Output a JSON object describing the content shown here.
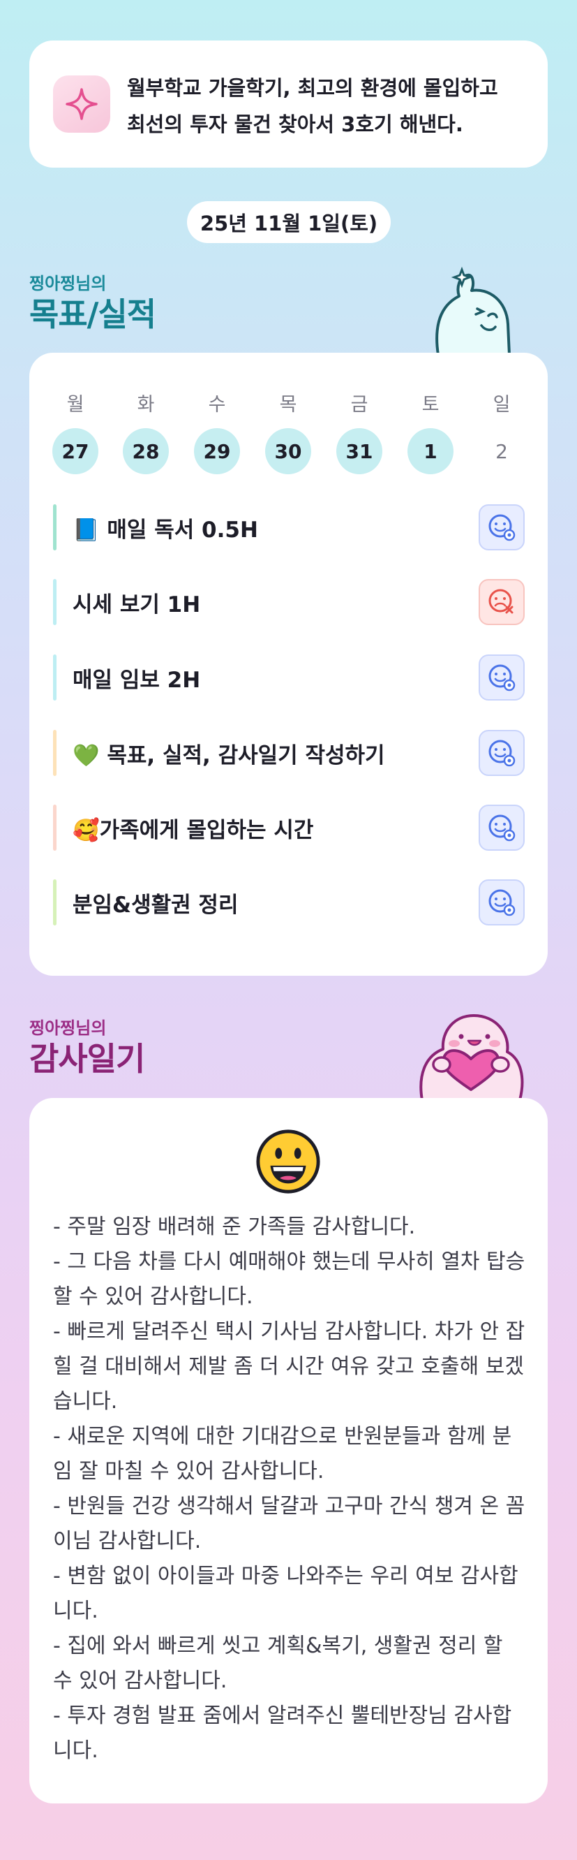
{
  "motto": {
    "icon": "sparkle-icon",
    "text": "월부학교 가을학기, 최고의 환경에 몰입하고\n최선의 투자 물건 찾아서 3호기 해낸다."
  },
  "date": "25년 11월 1일(토)",
  "goals_section": {
    "subtitle": "찡아찡님의",
    "title": "목표/실적",
    "week": {
      "day_names": [
        "월",
        "화",
        "수",
        "목",
        "금",
        "토",
        "일"
      ],
      "day_numbers": [
        "27",
        "28",
        "29",
        "30",
        "31",
        "1",
        "2"
      ],
      "active": [
        true,
        true,
        true,
        true,
        true,
        true,
        false
      ]
    },
    "goals": [
      {
        "label": "📘 매일 독서 0.5H",
        "status": "done",
        "bar_color": "#9fe3cf"
      },
      {
        "label": "시세 보기 1H",
        "status": "failed",
        "bar_color": "#bdeef3"
      },
      {
        "label": "매일 임보 2H",
        "status": "done",
        "bar_color": "#bdeef3"
      },
      {
        "label": "💚 목표, 실적, 감사일기 작성하기",
        "status": "done",
        "bar_color": "#fde2b8"
      },
      {
        "label": "🥰가족에게 몰입하는 시간",
        "status": "done",
        "bar_color": "#fbd6cc"
      },
      {
        "label": "분임&생활권 정리",
        "status": "done",
        "bar_color": "#d6f1b8"
      }
    ]
  },
  "thanks_section": {
    "subtitle": "찡아찡님의",
    "title": "감사일기",
    "emoji": "grinning-face-icon",
    "text": "- 주말 임장 배려해 준 가족들 감사합니다.\n- 그 다음 차를 다시 예매해야 했는데 무사히 열차 탑승 할 수 있어 감사합니다.\n- 빠르게 달려주신 택시 기사님 감사합니다. 차가 안 잡힐 걸 대비해서 제발 좀 더 시간 여유 갖고 호출해 보겠습니다.\n- 새로운 지역에 대한 기대감으로 반원분들과 함께 분임 잘 마칠 수 있어 감사합니다.\n- 반원들 건강 생각해서 달걀과 고구마 간식 챙겨 온 꼼이님 감사합니다.\n- 변함 없이 아이들과 마중 나와주는 우리 여보 감사합니다.\n- 집에 와서 빠르게 씻고 계획&복기, 생활권 정리 할 수 있어 감사합니다.\n- 투자 경험 발표 줌에서 알려주신 뿔테반장님 감사합니다."
  }
}
